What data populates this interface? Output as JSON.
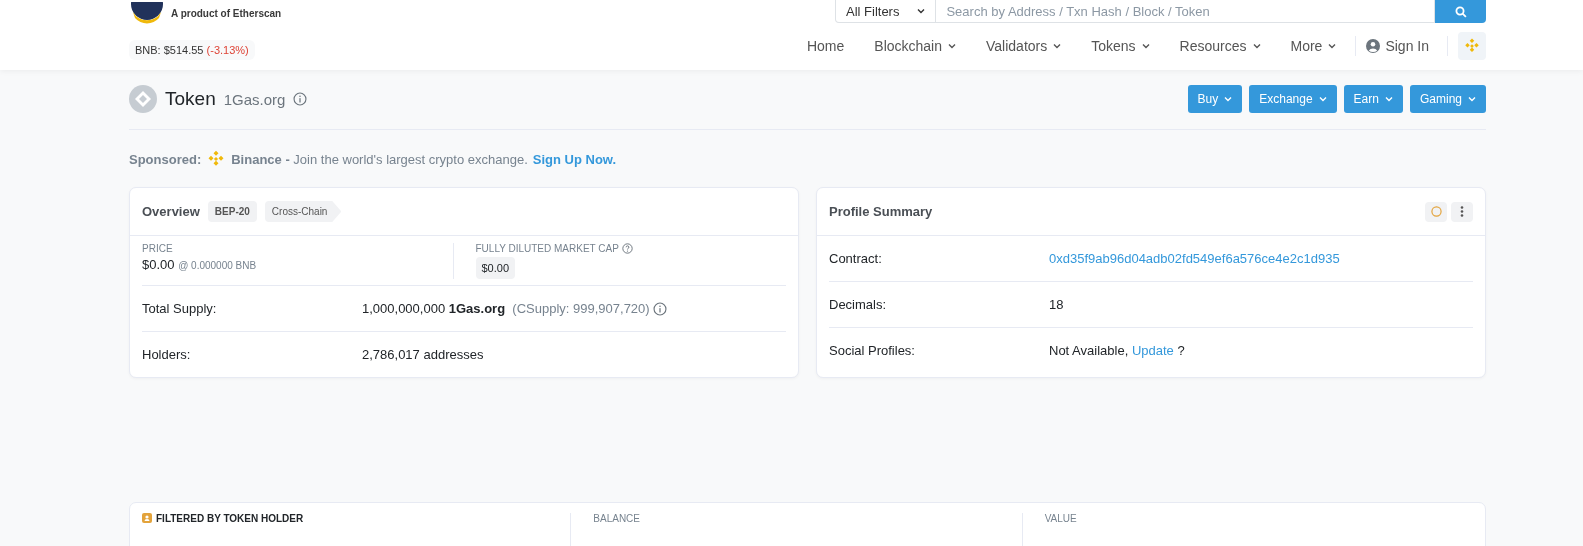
{
  "header": {
    "tagline": "A product of Etherscan",
    "price": {
      "label": "BNB: $514.55",
      "change": "(-3.13%)"
    },
    "search": {
      "filter": "All Filters",
      "placeholder": "Search by Address / Txn Hash / Block / Token"
    },
    "nav": [
      {
        "label": "Home",
        "dropdown": false
      },
      {
        "label": "Blockchain",
        "dropdown": true
      },
      {
        "label": "Validators",
        "dropdown": true
      },
      {
        "label": "Tokens",
        "dropdown": true
      },
      {
        "label": "Resources",
        "dropdown": true
      },
      {
        "label": "More",
        "dropdown": true
      }
    ],
    "sign_in": "Sign In"
  },
  "title": {
    "heading": "Token",
    "name": "1Gas.org",
    "buttons": [
      "Buy",
      "Exchange",
      "Earn",
      "Gaming"
    ]
  },
  "sponsored": {
    "label": "Sponsored:",
    "brand": "Binance -",
    "text": "Join the world's largest crypto exchange.",
    "link": "Sign Up Now."
  },
  "overview": {
    "title": "Overview",
    "tags": [
      {
        "label": "BEP-20",
        "kind": "tag"
      },
      {
        "label": "Cross-Chain",
        "kind": "arrow"
      }
    ],
    "price": {
      "label": "PRICE",
      "value": "$0.00",
      "sub": "@ 0.000000 BNB"
    },
    "market_cap": {
      "label": "FULLY DILUTED MARKET CAP",
      "value": "$0.00"
    },
    "total_supply": {
      "label": "Total Supply:",
      "amount": "1,000,000,000",
      "symbol": "1Gas.org",
      "csupply": "(CSupply: 999,907,720)"
    },
    "holders": {
      "label": "Holders:",
      "value": "2,786,017 addresses"
    }
  },
  "profile": {
    "title": "Profile Summary",
    "contract": {
      "label": "Contract:",
      "value": "0xd35f9ab96d04adb02fd549ef6a576ce4e2c1d935"
    },
    "decimals": {
      "label": "Decimals:",
      "value": "18"
    },
    "social": {
      "label": "Social Profiles:",
      "value": "Not Available,",
      "link": "Update",
      "suffix": "?"
    }
  },
  "holder_table": {
    "columns": [
      "FILTERED BY TOKEN HOLDER",
      "BALANCE",
      "VALUE"
    ]
  }
}
